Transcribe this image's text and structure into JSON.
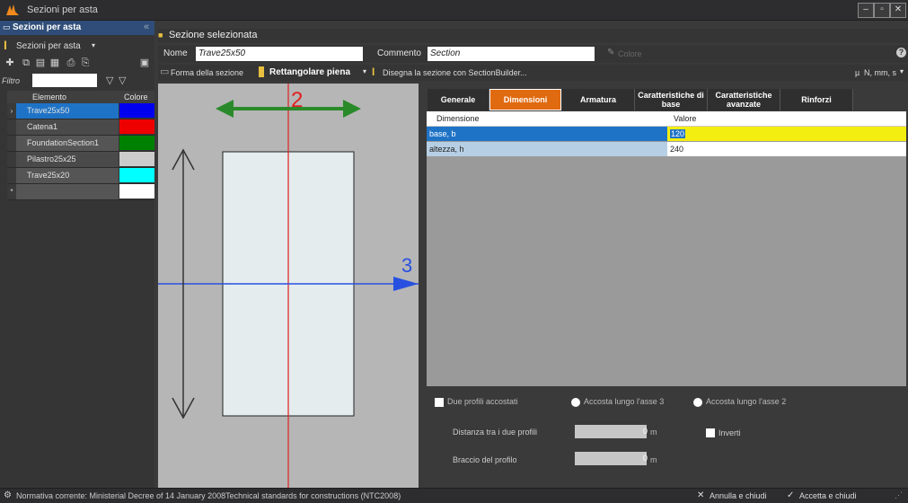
{
  "window": {
    "title": "Sezioni per asta"
  },
  "left": {
    "header": "Sezioni per asta",
    "dropdown": "Sezioni per asta",
    "filter_label": "Filtro",
    "columns": [
      "Elemento",
      "Colore"
    ],
    "rows": [
      {
        "name": "Trave25x50",
        "color": "#0000ee",
        "selected": true
      },
      {
        "name": "Catena1",
        "color": "#ee0000"
      },
      {
        "name": "FoundationSection1",
        "color": "#008000"
      },
      {
        "name": "Pilastro25x25",
        "color": "#cccccc"
      },
      {
        "name": "Trave25x20",
        "color": "#00ffff"
      }
    ],
    "new_row_marker": "*"
  },
  "section": {
    "header": "Sezione selezionata",
    "name_label": "Nome",
    "name_value": "Trave25x50",
    "comment_label": "Commento",
    "comment_value": "Section",
    "color_label": "Colore",
    "shape_label": "Forma della sezione",
    "shape_value": "Rettangolare piena",
    "builder_label": "Disegna la sezione con SectionBuilder...",
    "units": "N, mm, s"
  },
  "drawing": {
    "axis2": "2",
    "axis3": "3"
  },
  "tabs": [
    {
      "label": "Generale"
    },
    {
      "label": "Dimensioni",
      "active": true
    },
    {
      "label": "Armatura"
    },
    {
      "label": "Caratteristiche di base"
    },
    {
      "label": "Caratteristiche avanzate"
    },
    {
      "label": "Rinforzi"
    }
  ],
  "table": {
    "columns": [
      "Dimensione",
      "Valore"
    ],
    "rows": [
      {
        "name": "base, b",
        "value": "120",
        "selected": true
      },
      {
        "name": "altezza, h",
        "value": "240"
      }
    ]
  },
  "options": {
    "two_profiles": "Due profili accostati",
    "along3": "Accosta lungo l'asse 3",
    "along2": "Accosta lungo l'asse 2",
    "distance_label": "Distanza tra i due profili",
    "distance_value": "0",
    "arm_label": "Braccio del profilo",
    "arm_value": "0",
    "unit": "m",
    "invert": "Inverti"
  },
  "status": {
    "norm": "Normativa corrente:  Ministerial Decree of 14 January 2008Technical standards for constructions (NTC2008)",
    "cancel": "Annulla e chiudi",
    "accept": "Accetta e chiudi"
  }
}
